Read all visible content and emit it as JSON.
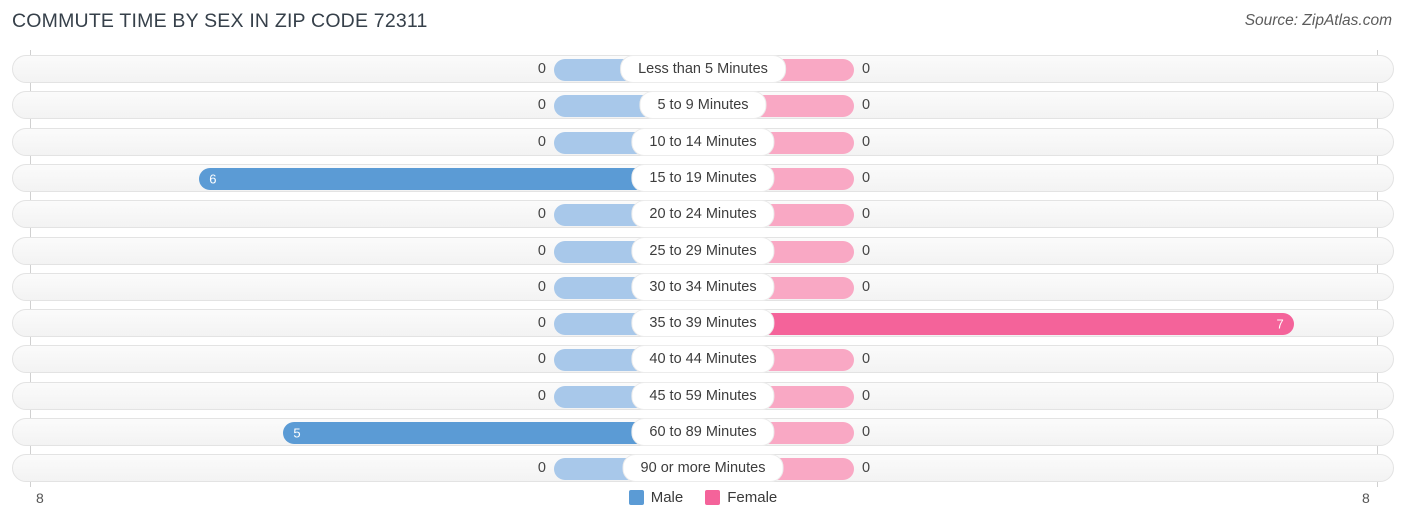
{
  "header": {
    "title": "COMMUTE TIME BY SEX IN ZIP CODE 72311",
    "source": "Source: ZipAtlas.com"
  },
  "axis": {
    "left_end_label": "8",
    "right_end_label": "8"
  },
  "legend": {
    "items": [
      {
        "label": "Male",
        "color": "#5b9bd5"
      },
      {
        "label": "Female",
        "color": "#f4639a"
      }
    ]
  },
  "colors": {
    "male_value": "#5b9bd5",
    "male_zero": "#a8c8ea",
    "female_value": "#f4639a",
    "female_zero": "#f9a8c4",
    "track": "#f5f5f5",
    "track_border": "#e3e3e3"
  },
  "chart_data": {
    "type": "bar",
    "title": "COMMUTE TIME BY SEX IN ZIP CODE 72311",
    "subtitle": "",
    "orientation": "horizontal-diverging",
    "xlabel": "",
    "ylabel": "",
    "xlim": [
      8,
      8
    ],
    "axis_max": 8,
    "grid": false,
    "legend_position": "bottom-center",
    "categories": [
      "Less than 5 Minutes",
      "5 to 9 Minutes",
      "10 to 14 Minutes",
      "15 to 19 Minutes",
      "20 to 24 Minutes",
      "25 to 29 Minutes",
      "30 to 34 Minutes",
      "35 to 39 Minutes",
      "40 to 44 Minutes",
      "45 to 59 Minutes",
      "60 to 89 Minutes",
      "90 or more Minutes"
    ],
    "series": [
      {
        "name": "Male",
        "side": "left",
        "color": "#5b9bd5",
        "values": [
          0,
          0,
          0,
          6,
          0,
          0,
          0,
          0,
          0,
          0,
          5,
          0
        ]
      },
      {
        "name": "Female",
        "side": "right",
        "color": "#f4639a",
        "values": [
          0,
          0,
          0,
          0,
          0,
          0,
          0,
          7,
          0,
          0,
          0,
          0
        ]
      }
    ]
  }
}
